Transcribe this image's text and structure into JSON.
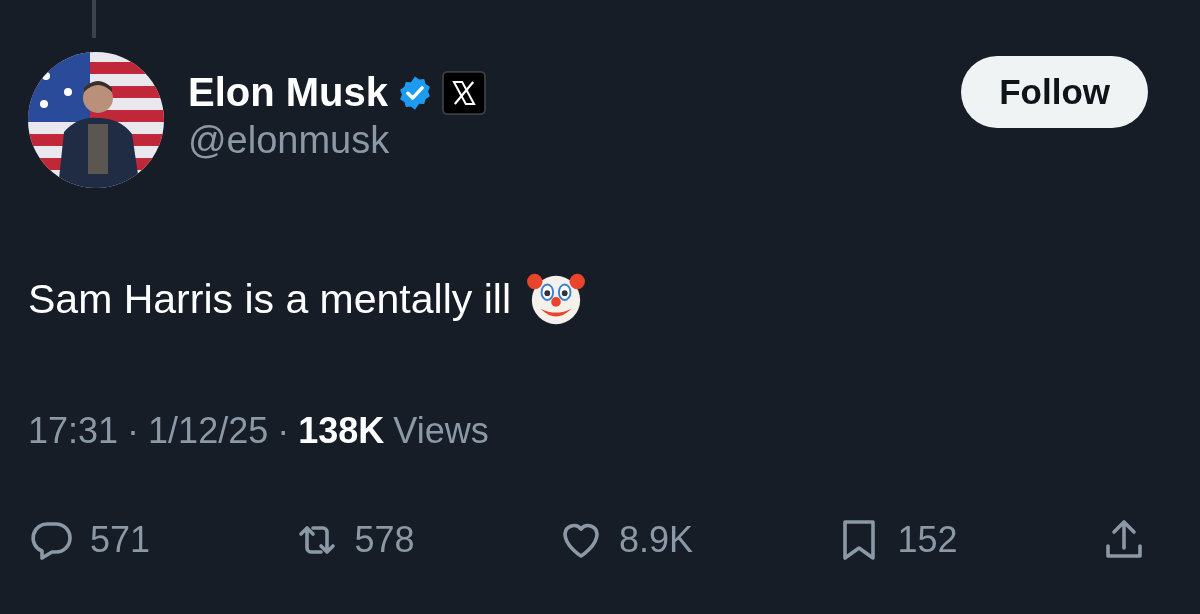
{
  "author": {
    "name": "Elon Musk",
    "verified": true,
    "handle": "@elonmusk"
  },
  "follow_button": {
    "label": "Follow"
  },
  "tweet": {
    "text": "Sam Harris is a mentally ill"
  },
  "meta": [
    {
      "kind": "plain",
      "text": "17:31"
    },
    {
      "kind": "plain",
      "text": "·"
    },
    {
      "kind": "plain",
      "text": "1/12/25"
    },
    {
      "kind": "plain",
      "text": "·"
    },
    {
      "kind": "bold",
      "text": "138K"
    },
    {
      "kind": "plain",
      "text": "Views"
    }
  ],
  "actions": [
    {
      "kind": "reply",
      "count": "571"
    },
    {
      "kind": "repost",
      "count": "578"
    },
    {
      "kind": "like",
      "count": "8.9K"
    },
    {
      "kind": "bookmark",
      "count": "152"
    },
    {
      "kind": "share"
    }
  ]
}
